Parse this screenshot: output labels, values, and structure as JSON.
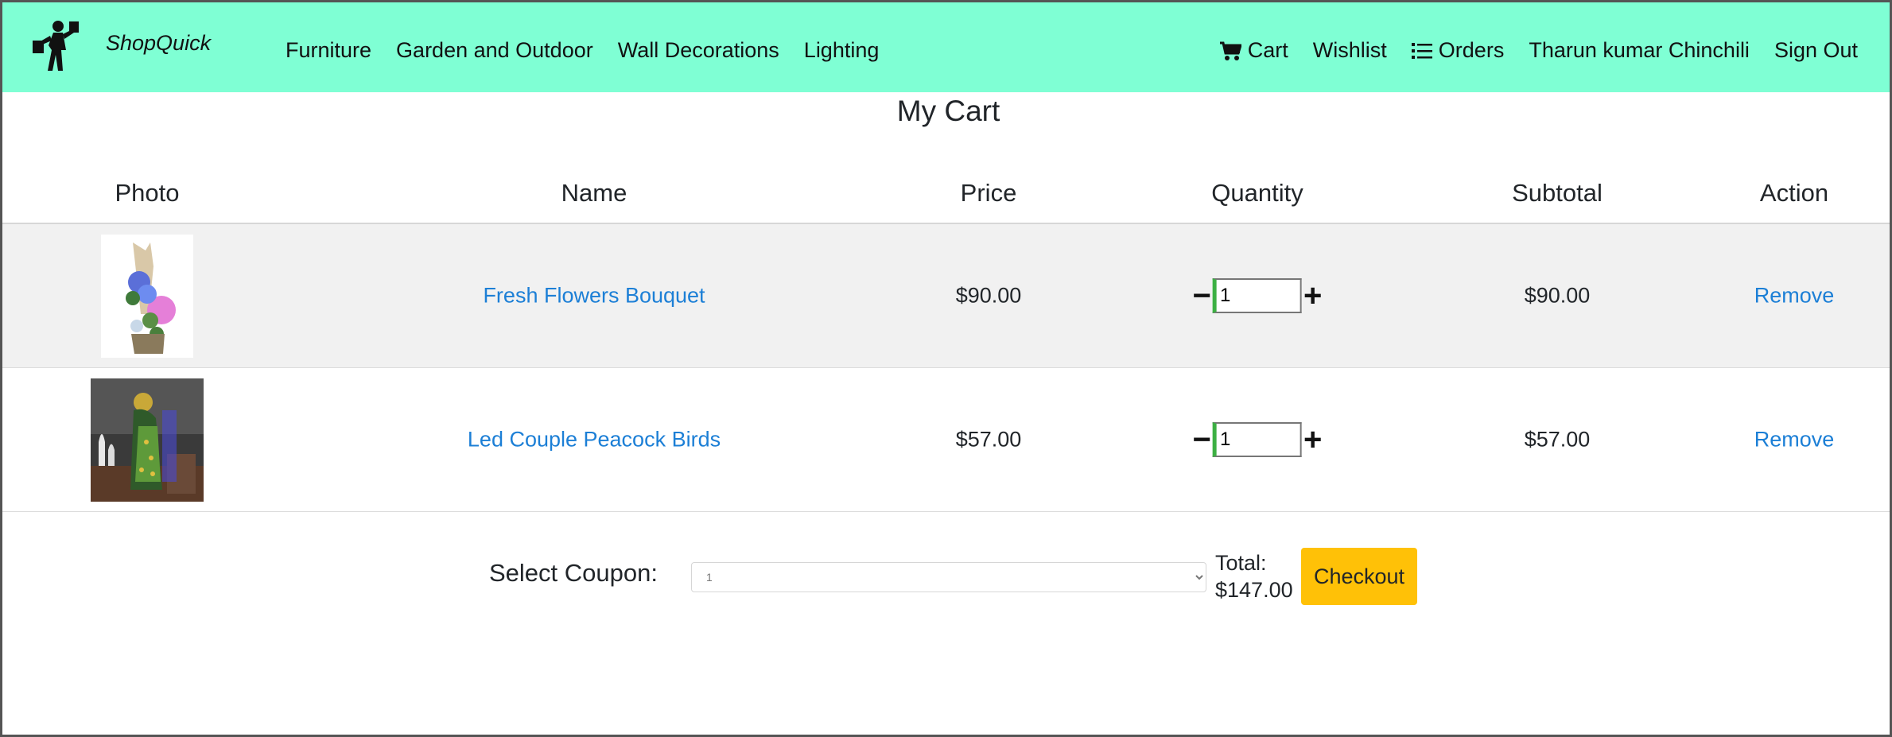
{
  "brand": {
    "name": "ShopQuick"
  },
  "nav": {
    "left": [
      "Furniture",
      "Garden and Outdoor",
      "Wall Decorations",
      "Lighting"
    ],
    "cart": "Cart",
    "wishlist": "Wishlist",
    "orders": "Orders",
    "user": "Tharun kumar Chinchili",
    "signout": "Sign Out"
  },
  "page": {
    "title": "My Cart"
  },
  "table": {
    "headers": {
      "photo": "Photo",
      "name": "Name",
      "price": "Price",
      "quantity": "Quantity",
      "subtotal": "Subtotal",
      "action": "Action"
    },
    "rows": [
      {
        "name": "Fresh Flowers Bouquet",
        "price": "$90.00",
        "quantity": "1",
        "subtotal": "$90.00",
        "action": "Remove"
      },
      {
        "name": "Led Couple Peacock Birds",
        "price": "$57.00",
        "quantity": "1",
        "subtotal": "$57.00",
        "action": "Remove"
      }
    ]
  },
  "footer": {
    "coupon_label": "Select Coupon:",
    "coupon_selected": "1",
    "total_label": "Total:",
    "total_value": "$147.00",
    "checkout_label": "Checkout"
  },
  "colors": {
    "navbar": "#7fffd4",
    "link": "#1c7fd6",
    "checkout": "#ffc107",
    "row_shade": "#f1f1f1",
    "qty_accent": "#3cb043"
  }
}
